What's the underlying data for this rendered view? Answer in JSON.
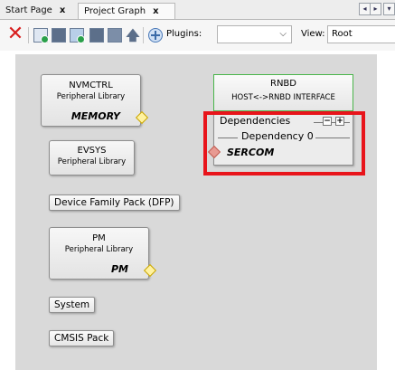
{
  "tabs": [
    {
      "label": "Start Page",
      "close": "x"
    },
    {
      "label": "Project Graph",
      "close": "x"
    }
  ],
  "tab_nav": {
    "prev": "◂",
    "next": "▸",
    "menu": "▾"
  },
  "toolbar": {
    "plugins_label": "Plugins:",
    "plugins_value": "",
    "view_label": "View:",
    "view_value": "Root",
    "dropdown_arrow": "⌵"
  },
  "nodes": {
    "nvmctrl": {
      "title": "NVMCTRL",
      "subtitle": "Peripheral Library",
      "tag": "MEMORY"
    },
    "evsys": {
      "title": "EVSYS",
      "subtitle": "Peripheral Library"
    },
    "dfp": {
      "label": "Device Family Pack (DFP)"
    },
    "pm": {
      "title": "PM",
      "subtitle": "Peripheral Library",
      "tag": "PM"
    },
    "system": {
      "label": "System"
    },
    "cmsis": {
      "label": "CMSIS Pack"
    },
    "rnbd": {
      "title": "RNBD",
      "subtitle": "HOST<->RNBD INTERFACE",
      "dependencies_label": "Dependencies",
      "dependency_0_label": "Dependency 0",
      "dependency_value": "SERCOM",
      "collapse": "−",
      "expand": "+"
    }
  },
  "colors": {
    "highlight": "#e8141b",
    "rnbd_border": "#49b54a",
    "canvas": "#d9d9d9",
    "delete_icon": "#d81e1e"
  },
  "icons": [
    "delete-icon",
    "add-component-icon",
    "component-icon",
    "add-icon",
    "component-dark-icon",
    "component-blue-icon",
    "up-arrow-icon",
    "fit-icon"
  ]
}
